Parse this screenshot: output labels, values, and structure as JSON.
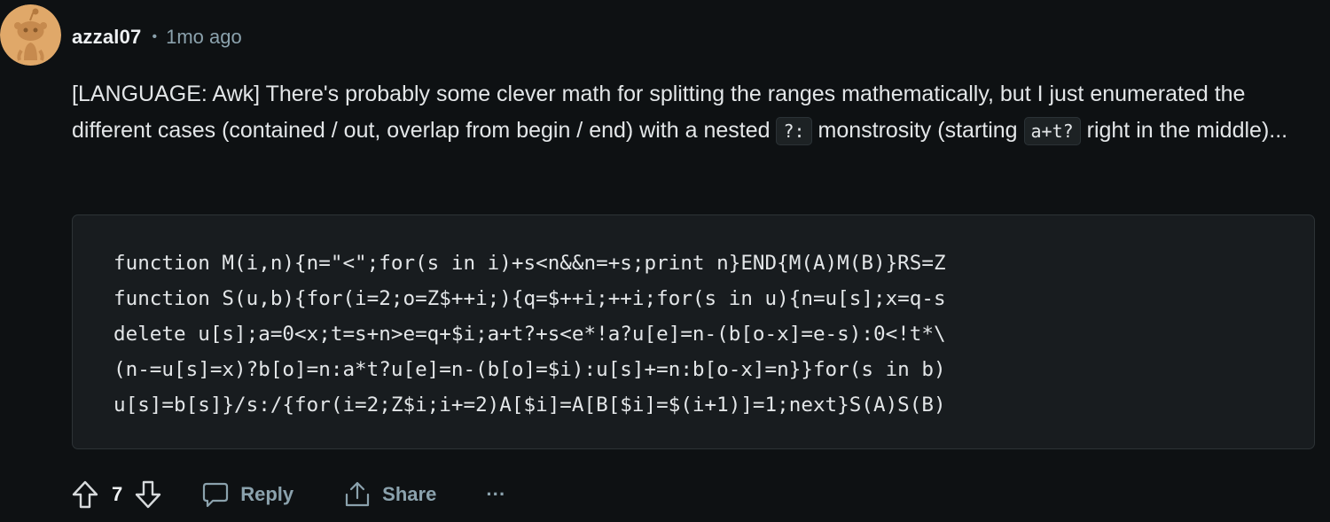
{
  "comment": {
    "author": "azzal07",
    "separator": "•",
    "timestamp": "1mo ago",
    "paragraph": {
      "text_1": "[LANGUAGE: Awk] There's probably some clever math for splitting the ranges mathematically, but I just enumerated the different cases (contained / out, overlap from begin / end) with a nested ",
      "code_1": "?:",
      "text_2": " monstrosity (starting ",
      "code_2": "a+t?",
      "text_3": " right in the middle)..."
    },
    "code_lines": [
      "function M(i,n){n=\"<\";for(s in i)+s<n&&n=+s;print n}END{M(A)M(B)}RS=Z",
      "function S(u,b){for(i=2;o=Z$++i;){q=$++i;++i;for(s in u){n=u[s];x=q-s",
      "delete u[s];a=0<x;t=s+n>e=q+$i;a+t?+s<e*!a?u[e]=n-(b[o-x]=e-s):0<!t*\\",
      "(n-=u[s]=x)?b[o]=n:a*t?u[e]=n-(b[o]=$i):u[s]+=n:b[o-x]=n}}for(s in b)",
      "u[s]=b[s]}/s:/{for(i=2;Z$i;i+=2)A[$i]=A[B[$i]=$(i+1)]=1;next}S(A)S(B)"
    ]
  },
  "actions": {
    "upvote_icon": "arrow-up-icon",
    "vote_count": "7",
    "downvote_icon": "arrow-down-icon",
    "reply_icon": "speech-bubble-icon",
    "reply_label": "Reply",
    "share_icon": "share-icon",
    "share_label": "Share",
    "more_label": "···"
  },
  "colors": {
    "background": "#0e1113",
    "avatar_bg": "#e0a869",
    "code_bg": "#181c1f",
    "muted_text": "#8ba2ad"
  }
}
